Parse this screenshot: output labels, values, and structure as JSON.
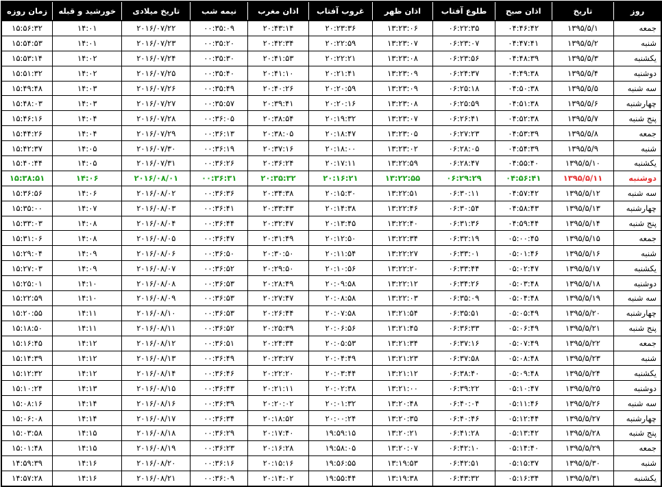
{
  "colors": {
    "header_bg": "#000000",
    "header_text": "#ffffff",
    "today_text": "#1e9e1e",
    "today_date": "#e53030"
  },
  "columns": {
    "day": "روز",
    "solar_date": "تاریخ",
    "fajr": "اذان صبح",
    "sunrise": "طلوع آفتاب",
    "dhuhr": "اذان ظهر",
    "sunset": "غروب آفتاب",
    "maghrib": "اذان مغرب",
    "midnight": "نیمه شب",
    "gregorian_date": "تاریخ میلادی",
    "qibla_sun": "خورشید و قبله",
    "day_length": "زمان روزه"
  },
  "rows": [
    {
      "day": "جمعه",
      "date": "۱۳۹۵/۵/۱",
      "fajr": "۰۴:۴۶:۴۲",
      "sunrise": "۰۶:۲۲:۳۵",
      "dhuhr": "۱۳:۲۳:۰۶",
      "sunset": "۲۰:۲۳:۳۶",
      "maghrib": "۲۰:۴۳:۱۴",
      "midnight": "۰۰:۳۵:۰۹",
      "gdate": "۲۰۱۶/۰۷/۲۲",
      "qibla": "۱۴:۰۱",
      "length": "۱۵:۵۶:۳۲"
    },
    {
      "day": "شنبه",
      "date": "۱۳۹۵/۵/۲",
      "fajr": "۰۴:۴۷:۴۱",
      "sunrise": "۰۶:۲۳:۰۷",
      "dhuhr": "۱۳:۲۳:۰۷",
      "sunset": "۲۰:۲۲:۵۹",
      "maghrib": "۲۰:۴۲:۳۴",
      "midnight": "۰۰:۳۵:۲۰",
      "gdate": "۲۰۱۶/۰۷/۲۳",
      "qibla": "۱۴:۰۱",
      "length": "۱۵:۵۴:۵۳"
    },
    {
      "day": "یکشنبه",
      "date": "۱۳۹۵/۵/۳",
      "fajr": "۰۴:۴۸:۳۹",
      "sunrise": "۰۶:۲۳:۵۶",
      "dhuhr": "۱۳:۲۳:۰۸",
      "sunset": "۲۰:۲۲:۲۱",
      "maghrib": "۲۰:۴۱:۵۳",
      "midnight": "۰۰:۳۵:۳۰",
      "gdate": "۲۰۱۶/۰۷/۲۴",
      "qibla": "۱۴:۰۲",
      "length": "۱۵:۵۳:۱۴"
    },
    {
      "day": "دوشنبه",
      "date": "۱۳۹۵/۵/۴",
      "fajr": "۰۴:۴۹:۳۸",
      "sunrise": "۰۶:۲۴:۳۷",
      "dhuhr": "۱۳:۲۳:۰۹",
      "sunset": "۲۰:۲۱:۴۱",
      "maghrib": "۲۰:۴۱:۱۰",
      "midnight": "۰۰:۳۵:۴۰",
      "gdate": "۲۰۱۶/۰۷/۲۵",
      "qibla": "۱۴:۰۲",
      "length": "۱۵:۵۱:۳۲"
    },
    {
      "day": "سه شنبه",
      "date": "۱۳۹۵/۵/۵",
      "fajr": "۰۴:۵۰:۳۸",
      "sunrise": "۰۶:۲۵:۱۸",
      "dhuhr": "۱۳:۲۳:۰۹",
      "sunset": "۲۰:۲۰:۵۹",
      "maghrib": "۲۰:۴۰:۲۶",
      "midnight": "۰۰:۳۵:۴۹",
      "gdate": "۲۰۱۶/۰۷/۲۶",
      "qibla": "۱۴:۰۳",
      "length": "۱۵:۴۹:۴۸"
    },
    {
      "day": "چهارشنبه",
      "date": "۱۳۹۵/۵/۶",
      "fajr": "۰۴:۵۱:۳۸",
      "sunrise": "۰۶:۲۵:۵۹",
      "dhuhr": "۱۳:۲۳:۰۸",
      "sunset": "۲۰:۲۰:۱۶",
      "maghrib": "۲۰:۳۹:۴۱",
      "midnight": "۰۰:۳۵:۵۷",
      "gdate": "۲۰۱۶/۰۷/۲۷",
      "qibla": "۱۴:۰۳",
      "length": "۱۵:۴۸:۰۳"
    },
    {
      "day": "پنج شنبه",
      "date": "۱۳۹۵/۵/۷",
      "fajr": "۰۴:۵۲:۳۸",
      "sunrise": "۰۶:۲۶:۴۱",
      "dhuhr": "۱۳:۲۳:۰۷",
      "sunset": "۲۰:۱۹:۳۲",
      "maghrib": "۲۰:۳۸:۵۴",
      "midnight": "۰۰:۳۶:۰۵",
      "gdate": "۲۰۱۶/۰۷/۲۸",
      "qibla": "۱۴:۰۴",
      "length": "۱۵:۴۶:۱۶"
    },
    {
      "day": "جمعه",
      "date": "۱۳۹۵/۵/۸",
      "fajr": "۰۴:۵۳:۳۹",
      "sunrise": "۰۶:۲۷:۲۳",
      "dhuhr": "۱۳:۲۳:۰۵",
      "sunset": "۲۰:۱۸:۴۷",
      "maghrib": "۲۰:۳۸:۰۵",
      "midnight": "۰۰:۳۶:۱۳",
      "gdate": "۲۰۱۶/۰۷/۲۹",
      "qibla": "۱۴:۰۴",
      "length": "۱۵:۴۴:۲۶"
    },
    {
      "day": "شنبه",
      "date": "۱۳۹۵/۵/۹",
      "fajr": "۰۴:۵۴:۳۹",
      "sunrise": "۰۶:۲۸:۰۵",
      "dhuhr": "۱۳:۲۳:۰۲",
      "sunset": "۲۰:۱۸:۰۰",
      "maghrib": "۲۰:۳۷:۱۶",
      "midnight": "۰۰:۳۶:۱۹",
      "gdate": "۲۰۱۶/۰۷/۳۰",
      "qibla": "۱۴:۰۵",
      "length": "۱۵:۴۲:۳۷"
    },
    {
      "day": "یکشنبه",
      "date": "۱۳۹۵/۵/۱۰",
      "fajr": "۰۴:۵۵:۴۰",
      "sunrise": "۰۶:۲۸:۴۷",
      "dhuhr": "۱۳:۲۲:۵۹",
      "sunset": "۲۰:۱۷:۱۱",
      "maghrib": "۲۰:۳۶:۲۴",
      "midnight": "۰۰:۳۶:۲۶",
      "gdate": "۲۰۱۶/۰۷/۳۱",
      "qibla": "۱۴:۰۵",
      "length": "۱۵:۴۰:۴۴"
    },
    {
      "day": "دوشنبه",
      "date": "۱۳۹۵/۵/۱۱",
      "fajr": "۰۴:۵۶:۴۱",
      "sunrise": "۰۶:۲۹:۲۹",
      "dhuhr": "۱۳:۲۲:۵۵",
      "sunset": "۲۰:۱۶:۲۱",
      "maghrib": "۲۰:۳۵:۳۲",
      "midnight": "۰۰:۳۶:۳۱",
      "gdate": "۲۰۱۶/۰۸/۰۱",
      "qibla": "۱۴:۰۶",
      "length": "۱۵:۳۸:۵۱",
      "today": true
    },
    {
      "day": "سه شنبه",
      "date": "۱۳۹۵/۵/۱۲",
      "fajr": "۰۴:۵۷:۴۲",
      "sunrise": "۰۶:۳۰:۱۱",
      "dhuhr": "۱۳:۲۲:۵۱",
      "sunset": "۲۰:۱۵:۳۰",
      "maghrib": "۲۰:۳۴:۳۸",
      "midnight": "۰۰:۳۶:۳۶",
      "gdate": "۲۰۱۶/۰۸/۰۲",
      "qibla": "۱۴:۰۶",
      "length": "۱۵:۳۶:۵۶"
    },
    {
      "day": "چهارشنبه",
      "date": "۱۳۹۵/۵/۱۳",
      "fajr": "۰۴:۵۸:۴۳",
      "sunrise": "۰۶:۳۰:۵۴",
      "dhuhr": "۱۳:۲۲:۴۶",
      "sunset": "۲۰:۱۴:۳۸",
      "maghrib": "۲۰:۳۳:۴۳",
      "midnight": "۰۰:۳۶:۴۱",
      "gdate": "۲۰۱۶/۰۸/۰۳",
      "qibla": "۱۴:۰۷",
      "length": "۱۵:۳۵:۰۰"
    },
    {
      "day": "پنج شنبه",
      "date": "۱۳۹۵/۵/۱۴",
      "fajr": "۰۴:۵۹:۴۴",
      "sunrise": "۰۶:۳۱:۳۶",
      "dhuhr": "۱۳:۲۲:۴۰",
      "sunset": "۲۰:۱۳:۴۵",
      "maghrib": "۲۰:۳۲:۴۷",
      "midnight": "۰۰:۳۶:۴۴",
      "gdate": "۲۰۱۶/۰۸/۰۴",
      "qibla": "۱۴:۰۸",
      "length": "۱۵:۳۳:۰۳"
    },
    {
      "day": "جمعه",
      "date": "۱۳۹۵/۵/۱۵",
      "fajr": "۰۵:۰۰:۴۵",
      "sunrise": "۰۶:۳۲:۱۹",
      "dhuhr": "۱۳:۲۲:۳۴",
      "sunset": "۲۰:۱۲:۵۰",
      "maghrib": "۲۰:۳۱:۴۹",
      "midnight": "۰۰:۳۶:۴۷",
      "gdate": "۲۰۱۶/۰۸/۰۵",
      "qibla": "۱۴:۰۸",
      "length": "۱۵:۳۱:۰۶"
    },
    {
      "day": "شنبه",
      "date": "۱۳۹۵/۵/۱۶",
      "fajr": "۰۵:۰۱:۴۶",
      "sunrise": "۰۶:۳۳:۰۱",
      "dhuhr": "۱۳:۲۲:۲۷",
      "sunset": "۲۰:۱۱:۵۴",
      "maghrib": "۲۰:۳۰:۵۰",
      "midnight": "۰۰:۳۶:۵۰",
      "gdate": "۲۰۱۶/۰۸/۰۶",
      "qibla": "۱۴:۰۹",
      "length": "۱۵:۲۹:۰۴"
    },
    {
      "day": "یکشنبه",
      "date": "۱۳۹۵/۵/۱۷",
      "fajr": "۰۵:۰۲:۴۷",
      "sunrise": "۰۶:۳۳:۴۴",
      "dhuhr": "۱۳:۲۲:۲۰",
      "sunset": "۲۰:۱۰:۵۶",
      "maghrib": "۲۰:۲۹:۵۰",
      "midnight": "۰۰:۳۶:۵۲",
      "gdate": "۲۰۱۶/۰۸/۰۷",
      "qibla": "۱۴:۰۹",
      "length": "۱۵:۲۷:۰۳"
    },
    {
      "day": "دوشنبه",
      "date": "۱۳۹۵/۵/۱۸",
      "fajr": "۰۵:۰۳:۴۸",
      "sunrise": "۰۶:۳۴:۲۶",
      "dhuhr": "۱۳:۲۲:۱۲",
      "sunset": "۲۰:۰۹:۵۸",
      "maghrib": "۲۰:۲۸:۴۹",
      "midnight": "۰۰:۳۶:۵۳",
      "gdate": "۲۰۱۶/۰۸/۰۸",
      "qibla": "۱۴:۱۰",
      "length": "۱۵:۲۵:۰۱"
    },
    {
      "day": "سه شنبه",
      "date": "۱۳۹۵/۵/۱۹",
      "fajr": "۰۵:۰۴:۴۸",
      "sunrise": "۰۶:۳۵:۰۹",
      "dhuhr": "۱۳:۲۲:۰۳",
      "sunset": "۲۰:۰۸:۵۸",
      "maghrib": "۲۰:۲۷:۴۷",
      "midnight": "۰۰:۳۶:۵۳",
      "gdate": "۲۰۱۶/۰۸/۰۹",
      "qibla": "۱۴:۱۰",
      "length": "۱۵:۲۲:۵۹"
    },
    {
      "day": "چهارشنبه",
      "date": "۱۳۹۵/۵/۲۰",
      "fajr": "۰۵:۰۵:۴۹",
      "sunrise": "۰۶:۳۵:۵۱",
      "dhuhr": "۱۳:۲۱:۵۴",
      "sunset": "۲۰:۰۷:۵۸",
      "maghrib": "۲۰:۲۶:۴۴",
      "midnight": "۰۰:۳۶:۵۳",
      "gdate": "۲۰۱۶/۰۸/۱۰",
      "qibla": "۱۴:۱۱",
      "length": "۱۵:۲۰:۵۵"
    },
    {
      "day": "پنج شنبه",
      "date": "۱۳۹۵/۵/۲۱",
      "fajr": "۰۵:۰۶:۴۹",
      "sunrise": "۰۶:۳۶:۳۳",
      "dhuhr": "۱۳:۲۱:۴۵",
      "sunset": "۲۰:۰۶:۵۶",
      "maghrib": "۲۰:۲۵:۳۹",
      "midnight": "۰۰:۳۶:۵۲",
      "gdate": "۲۰۱۶/۰۸/۱۱",
      "qibla": "۱۴:۱۱",
      "length": "۱۵:۱۸:۵۰"
    },
    {
      "day": "جمعه",
      "date": "۱۳۹۵/۵/۲۲",
      "fajr": "۰۵:۰۷:۴۹",
      "sunrise": "۰۶:۳۷:۱۶",
      "dhuhr": "۱۳:۲۱:۳۴",
      "sunset": "۲۰:۰۵:۵۳",
      "maghrib": "۲۰:۲۴:۳۴",
      "midnight": "۰۰:۳۶:۵۱",
      "gdate": "۲۰۱۶/۰۸/۱۲",
      "qibla": "۱۴:۱۲",
      "length": "۱۵:۱۶:۴۵"
    },
    {
      "day": "شنبه",
      "date": "۱۳۹۵/۵/۲۳",
      "fajr": "۰۵:۰۸:۴۸",
      "sunrise": "۰۶:۳۷:۵۸",
      "dhuhr": "۱۳:۲۱:۲۳",
      "sunset": "۲۰:۰۴:۴۹",
      "maghrib": "۲۰:۲۳:۲۷",
      "midnight": "۰۰:۳۶:۴۹",
      "gdate": "۲۰۱۶/۰۸/۱۳",
      "qibla": "۱۴:۱۲",
      "length": "۱۵:۱۴:۳۹"
    },
    {
      "day": "یکشنبه",
      "date": "۱۳۹۵/۵/۲۴",
      "fajr": "۰۵:۰۹:۴۸",
      "sunrise": "۰۶:۳۸:۴۰",
      "dhuhr": "۱۳:۲۱:۱۲",
      "sunset": "۲۰:۰۳:۴۴",
      "maghrib": "۲۰:۲۲:۲۰",
      "midnight": "۰۰:۳۶:۴۶",
      "gdate": "۲۰۱۶/۰۸/۱۴",
      "qibla": "۱۴:۱۲",
      "length": "۱۵:۱۲:۳۲"
    },
    {
      "day": "دوشنبه",
      "date": "۱۳۹۵/۵/۲۵",
      "fajr": "۰۵:۱۰:۴۷",
      "sunrise": "۰۶:۳۹:۲۲",
      "dhuhr": "۱۳:۲۱:۰۰",
      "sunset": "۲۰:۰۲:۳۸",
      "maghrib": "۲۰:۲۱:۱۱",
      "midnight": "۰۰:۳۶:۴۳",
      "gdate": "۲۰۱۶/۰۸/۱۵",
      "qibla": "۱۴:۱۳",
      "length": "۱۵:۱۰:۲۴"
    },
    {
      "day": "سه شنبه",
      "date": "۱۳۹۵/۵/۲۶",
      "fajr": "۰۵:۱۱:۴۶",
      "sunrise": "۰۶:۴۰:۰۴",
      "dhuhr": "۱۳:۲۰:۴۸",
      "sunset": "۲۰:۰۱:۳۲",
      "maghrib": "۲۰:۲۰:۰۲",
      "midnight": "۰۰:۳۶:۳۹",
      "gdate": "۲۰۱۶/۰۸/۱۶",
      "qibla": "۱۴:۱۴",
      "length": "۱۵:۰۸:۱۶"
    },
    {
      "day": "چهارشنبه",
      "date": "۱۳۹۵/۵/۲۷",
      "fajr": "۰۵:۱۲:۴۴",
      "sunrise": "۰۶:۴۰:۴۶",
      "dhuhr": "۱۳:۲۰:۳۵",
      "sunset": "۲۰:۰۰:۲۴",
      "maghrib": "۲۰:۱۸:۵۲",
      "midnight": "۰۰:۳۶:۳۴",
      "gdate": "۲۰۱۶/۰۸/۱۷",
      "qibla": "۱۴:۱۴",
      "length": "۱۵:۰۶:۰۸"
    },
    {
      "day": "پنج شنبه",
      "date": "۱۳۹۵/۵/۲۸",
      "fajr": "۰۵:۱۳:۴۲",
      "sunrise": "۰۶:۴۱:۲۸",
      "dhuhr": "۱۳:۲۰:۲۱",
      "sunset": "۱۹:۵۹:۱۵",
      "maghrib": "۲۰:۱۷:۴۰",
      "midnight": "۰۰:۳۶:۲۹",
      "gdate": "۲۰۱۶/۰۸/۱۸",
      "qibla": "۱۴:۱۵",
      "length": "۱۵:۰۳:۵۸"
    },
    {
      "day": "جمعه",
      "date": "۱۳۹۵/۵/۲۹",
      "fajr": "۰۵:۱۴:۴۰",
      "sunrise": "۰۶:۴۲:۱۰",
      "dhuhr": "۱۳:۲۰:۰۷",
      "sunset": "۱۹:۵۸:۰۵",
      "maghrib": "۲۰:۱۶:۲۸",
      "midnight": "۰۰:۳۶:۲۳",
      "gdate": "۲۰۱۶/۰۸/۱۹",
      "qibla": "۱۴:۱۵",
      "length": "۱۵:۰۱:۴۸"
    },
    {
      "day": "شنبه",
      "date": "۱۳۹۵/۵/۳۰",
      "fajr": "۰۵:۱۵:۳۷",
      "sunrise": "۰۶:۴۲:۵۱",
      "dhuhr": "۱۳:۱۹:۵۳",
      "sunset": "۱۹:۵۶:۵۵",
      "maghrib": "۲۰:۱۵:۱۶",
      "midnight": "۰۰:۳۶:۱۶",
      "gdate": "۲۰۱۶/۰۸/۲۰",
      "qibla": "۱۴:۱۶",
      "length": "۱۴:۵۹:۳۹"
    },
    {
      "day": "یکشنبه",
      "date": "۱۳۹۵/۵/۳۱",
      "fajr": "۰۵:۱۶:۳۴",
      "sunrise": "۰۶:۴۳:۳۲",
      "dhuhr": "۱۳:۱۹:۳۸",
      "sunset": "۱۹:۵۵:۴۴",
      "maghrib": "۲۰:۱۴:۰۲",
      "midnight": "۰۰:۳۶:۰۹",
      "gdate": "۲۰۱۶/۰۸/۲۱",
      "qibla": "۱۴:۱۶",
      "length": "۱۴:۵۷:۲۸"
    }
  ]
}
